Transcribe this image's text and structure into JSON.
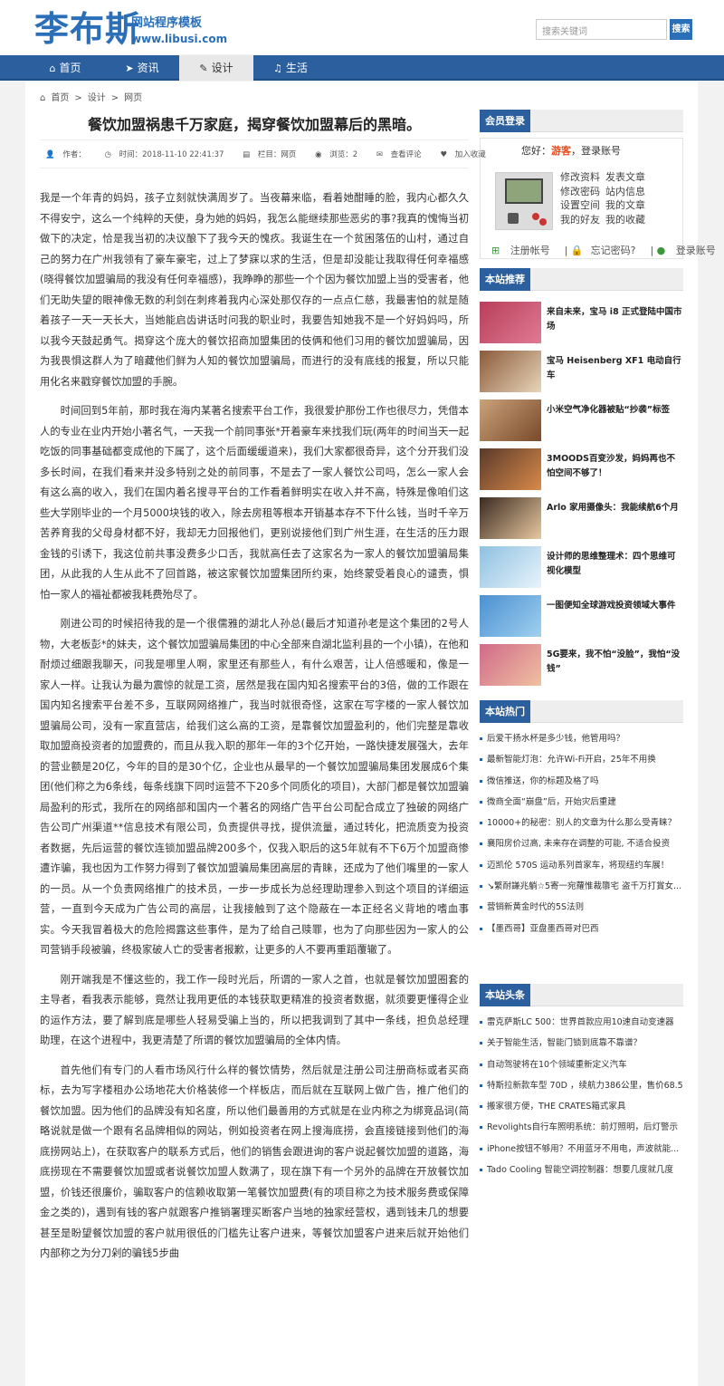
{
  "header": {
    "logo_main": "李布斯",
    "logo_sub": "网站程序模板",
    "logo_url": "www.libusi.com",
    "search_placeholder": "搜索关键词",
    "search_button": "搜索"
  },
  "nav": [
    {
      "label": "首页",
      "icon": "home-icon",
      "glyph": "⌂"
    },
    {
      "label": "资讯",
      "icon": "send-icon",
      "glyph": "➤"
    },
    {
      "label": "设计",
      "icon": "leaf-icon",
      "glyph": "✎"
    },
    {
      "label": "生活",
      "icon": "music-icon",
      "glyph": "♫"
    }
  ],
  "breadcrumb": {
    "home": "首页",
    "sep": ">",
    "c1": "设计",
    "c2": "网页"
  },
  "article": {
    "title": "餐饮加盟祸患千万家庭，揭穿餐饮加盟幕后的黑暗。",
    "meta_author": "作者：",
    "meta_time": "时间：2018-11-10 22:41:37",
    "meta_column": "栏目：网页",
    "meta_views": "浏览：2",
    "meta_comments": "查看评论",
    "meta_fav": "加入收藏",
    "paragraphs": [
      "我是一个年青的妈妈，孩子立刻就快满周岁了。当夜幕来临，看着她酣睡的脸，我内心都久久不得安宁，这么一个纯粹的天使，身为她的妈妈，我怎么能继续那些恶劣的事?我真的愧悔当初做下的决定，恰是我当初的决议酿下了我今天的愧疚。我诞生在一个贫困落伍的山村，通过自己的努力在广州我领有了豪车豪宅，过上了梦寐以求的生活，但是却没能让我取得任何幸福感(晓得餐饮加盟骗局的我没有任何幸福感)，我睁睁的那些一个个因为餐饮加盟上当的受害者，他们无助失望的眼神像无数的利剑在刺疼着我内心深处那仅存的一点点仁慈，我最害怕的就是随着孩子一天一天长大，当她能启齿讲话时问我的职业时，我要告知她我不是一个好妈妈吗，所以我今天鼓起勇气。揭穿这个庞大的餐饮招商加盟集团的伎俩和他们习用的餐饮加盟骗局，因为我畏惧这群人为了暗藏他们鲜为人知的餐饮加盟骗局，而进行的没有底线的报复，所以只能用化名来戳穿餐饮加盟的手腕。",
      "时间回到5年前，那时我在海内某著名搜索平台工作，我很爱护那份工作也很尽力，凭借本人的专业在业内开始小著名气，一天我一个前同事张*开着豪车来找我们玩(两年的时间当天一起吃饭的同事基础都变成他的下属了，这个后面缓缓道来)，我们大家都很奇异，这个分开我们没多长时间，在我们看来并没多特别之处的前同事，不是去了一家人餐饮公司吗，怎么一家人会有这么高的收入，我们在国内着名搜寻平台的工作看着鲜明实在收入并不高，特殊是像咱们这些大学刚毕业的一个月5000块钱的收入，除去房租等根本开销基本存不下什么钱，当时千辛万苦养育我的父母身材都不好，我却无力回报他们，更别说接他们到广州生涯，在生活的压力跟金钱的引诱下，我这位前共事没费多少口舌，我就高任去了这家名为一家人的餐饮加盟骗局集团，从此我的人生从此不了回首路，被这家餐饮加盟集团所约束，始终蒙受着良心的谴责，惧怕一家人的福祉都被我耗费殆尽了。",
      "刚进公司的时候招待我的是一个很儒雅的湖北人孙总(最后才知道孙老是这个集团的2号人物，大老板彭*的妹夫，这个餐饮加盟骗局集团的中心全部来自湖北监利县的一个小镇)，在他和耐烦过细跟我聊天，问我是哪里人啊，家里还有那些人，有什么艰苦，让人倍感暖和，像是一家人一样。让我认为最为震惊的就是工资，居然是我在国内知名搜索平台的3倍，做的工作跟在国内知名搜索平台差不多，互联网网络推广，我当时就很奇怪，这家在写字楼的一家人餐饮加盟骗局公司，没有一家直营店，给我们这么高的工资，是靠餐饮加盟盈利的，他们完整是靠收取加盟商投资者的加盟费的，而且从我入职的那年一年的3个亿开始，一路快捷发展强大，去年的营业额是20亿，今年的目的是30个亿，企业也从最早的一个餐饮加盟骗局集团发展成6个集团(他们称之为6条线，每条线旗下同时运营不下20多个同质化的项目)，大部门都是餐饮加盟骗局盈利的形式，我所在的网络部和国内一个著名的网络广告平台公司配合成立了独破的网络广告公司广州渠道**信息技术有限公司，负责提供寻找，提供流量，通过转化，把流质变为投资者数据，先后运营的餐饮连锁加盟品牌200多个，仅我入职后的这5年就有不下6万个加盟商惨遭诈骗，我也因为工作努力得到了餐饮加盟骗局集团高层的青睐，还成为了他们嘴里的一家人的一员。从一个负责网络推广的技术员，一步一步成长为总经理助理参入到这个项目的详细运营，一直到今天成为广告公司的高层，让我接触到了这个隐蔽在一本正经名义背地的嗜血事实。今天我冒着极大的危险揭露这些事件，是为了给自己赎罪，也为了向那些因为一家人的公司营销手段被骗，终极家破人亡的受害者报歉，让更多的人不要再重蹈覆辙了。",
      "刚开端我是不懂这些的，我工作一段时光后，所谓的一家人之首，也就是餐饮加盟圈套的主导者，看我表示能够，竟然让我用更低的本钱获取更精准的投资者数据，就须要更懂得企业的运作方法，要了解到底是哪些人轻易受骗上当的，所以把我调到了其中一条线，担负总经理助理，在这个进程中，我更清楚了所谓的餐饮加盟骗局的全体内情。",
      "首先他们有专门的人看市场风行什么样的餐饮情势，然后就是注册公司注册商标或者买商标，去为写字楼租办公场地花大价格装修一个样板店，而后就在互联网上做广告，推广他们的餐饮加盟。因为他们的品牌没有知名度，所以他们最善用的方式就是在业内称之为绑竞品词(简略说就是做一个跟有名品牌相似的网站，例如投资者在网上搜海底捞，会直接链接到他们的海底捞网站上)，在获取客户的联系方式后，他们的销售会跟进询的客户说起餐饮加盟的道路，海底捞现在不需要餐饮加盟或者说餐饮加盟人数满了，现在旗下有一个另外的品牌在开放餐饮加盟，价钱还很廉价，骗取客户的信赖收取第一笔餐饮加盟费(有的项目称之为技术服务费或保障金之类的)，遇到有钱的客户就跟客户推销署理买断客户当地的独家经营权，遇到钱未几的想要甚至是盼望餐饮加盟的客户就用很低的门槛先让客户进来，等餐饮加盟客户进来后就开始他们内部称之为分刀剁的骗钱5步曲"
    ]
  },
  "sidebar": {
    "login": {
      "title": "会员登录",
      "hello_prefix": "您好：",
      "hello_guest": "游客",
      "hello_suffix": "，登录账号",
      "links": [
        "修改资料",
        "发表文章",
        "修改密码",
        "站内信息",
        "设置空间",
        "我的文章",
        "我的好友",
        "我的收藏"
      ],
      "register": "注册帐号",
      "forgot": "忘记密码?",
      "signin": "登录账号"
    },
    "recommend": {
      "title": "本站推荐",
      "items": [
        {
          "text": "来自未来，宝马 i8 正式登陆中国市场",
          "colors": [
            "#b83e5a",
            "#e07a93"
          ]
        },
        {
          "text": "宝马 Heisenberg XF1 电动自行车",
          "colors": [
            "#8b5a3c",
            "#e8d5b8"
          ]
        },
        {
          "text": "小米空气净化器被贴“抄袭”标签",
          "colors": [
            "#c9a27a",
            "#7a4a2a"
          ]
        },
        {
          "text": "3MOODS百变沙发，妈妈再也不怕空间不够了！",
          "colors": [
            "#5a3a2a",
            "#d98a4a"
          ]
        },
        {
          "text": "Arlo 家用摄像头：我能续航6个月",
          "colors": [
            "#3a2a20",
            "#e8c8a0"
          ]
        },
        {
          "text": "设计师的思维整理术：四个思维可视化模型",
          "colors": [
            "#8ec0e0",
            "#e8f4fb"
          ]
        },
        {
          "text": "一图便知全球游戏投资领域大事件",
          "colors": [
            "#4a90d0",
            "#a0d0f0"
          ]
        },
        {
          "text": "5G要来，我不怕“没脸”，我怕“没钱”",
          "colors": [
            "#d06a8a",
            "#f0c0a0"
          ]
        }
      ]
    },
    "hot": {
      "title": "本站热门",
      "items": [
        "后爱干扬水杯是多少钱，他管用吗？",
        "最新智能灯泡：允许Wi-Fi开启，25年不用换",
        "微信推送，你的标题及格了吗",
        "微商全面“崩盘”后，开始灾后重建",
        "10000+的秘密：别人的文章为什么那么受青睐？",
        "襄阳房价过高, 未来存在调整的可能, 不适合投资",
        "迈凯伦 570S 运动系列首家车，将现纽约车展！",
        "↘繁耐謙兆躺☆5寄一宛蘿惟裁隳宅 盗千万打賞女...",
        "营销新黄金时代的5S法则",
        "【墨西哥】亚盘墨西哥对巴西"
      ]
    },
    "headline": {
      "title": "本站头条",
      "items": [
        "雷克萨斯LC 500：世界首款应用10速自动变速器",
        "关于智能生活，智能门锁到底靠不靠谱？",
        "自动驾驶将在10个领域重新定义汽车",
        "特斯拉新款车型 70D ，续航力386公里，售价68.5...",
        "搬家很方便，THE CRATES箱式家具",
        "Revolights自行车照明系统：前灯照明，后灯警示",
        "iPhone按钮不够用？不用蓝牙不用电，声波就能...",
        "Tado Cooling 智能空调控制器：想要几度就几度"
      ]
    }
  }
}
